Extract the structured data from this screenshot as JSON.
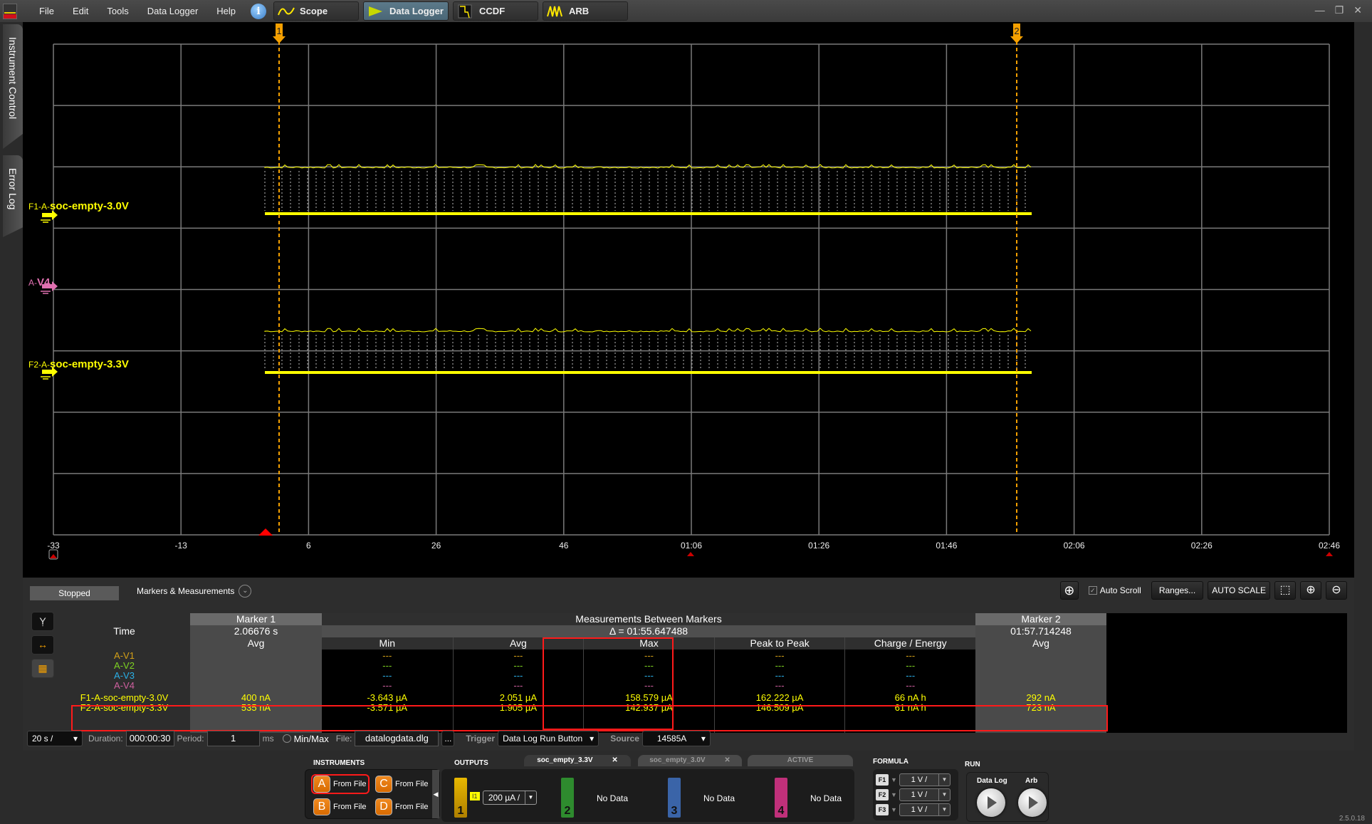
{
  "menubar": {
    "items": [
      "File",
      "Edit",
      "Tools",
      "Data Logger",
      "Help"
    ],
    "mode_tabs": [
      {
        "label": "Scope",
        "icon": "sine-wave-icon",
        "active": false
      },
      {
        "label": "Data Logger",
        "icon": "datalogger-icon",
        "active": true
      },
      {
        "label": "CCDF",
        "icon": "ccdf-icon",
        "active": false
      },
      {
        "label": "ARB",
        "icon": "arb-wave-icon",
        "active": false
      }
    ],
    "window_controls": {
      "minimize": "—",
      "restore": "❐",
      "close": "✕"
    }
  },
  "side_tabs": [
    "Instrument Control",
    "Error Log"
  ],
  "plot": {
    "x_ticks": [
      "-33",
      "-13",
      "6",
      "26",
      "46",
      "01:06",
      "01:26",
      "01:46",
      "02:06",
      "02:26",
      "02:46"
    ],
    "marker1_label": "1",
    "marker2_label": "2",
    "traces": [
      {
        "prefix": "F1-A-",
        "name": "soc-empty-3.0V",
        "color": "#ffff00"
      },
      {
        "prefix": "A-",
        "name": "V4",
        "color": "#e070b0"
      },
      {
        "prefix": "F2-A-",
        "name": "soc-empty-3.3V",
        "color": "#ffff00"
      }
    ],
    "nav": {
      "first": "<<",
      "prev": "<",
      "next": ">",
      "last": ">>"
    }
  },
  "colors": {
    "trace_yellow": "#ffff00",
    "marker_orange": "#f5a000",
    "highlight_red": "#ff1a1a",
    "v1": "#d4a017",
    "v2": "#7ed321",
    "v3": "#2ab0e8",
    "v4": "#d060a0"
  },
  "measurements": {
    "status": "Stopped",
    "section_label": "Markers & Measurements",
    "toolbar": {
      "auto_scroll": "Auto Scroll",
      "ranges": "Ranges...",
      "auto_scale": "AUTO SCALE"
    },
    "time_label": "Time",
    "marker1": {
      "title": "Marker 1",
      "time": "2.06676 s",
      "sub": "Avg"
    },
    "between": {
      "title": "Measurements Between Markers",
      "delta": "Δ = 01:55.647488"
    },
    "marker2": {
      "title": "Marker 2",
      "time": "01:57.714248",
      "sub": "Avg"
    },
    "columns": [
      "Min",
      "Avg",
      "Max",
      "Peak to Peak",
      "Charge / Energy"
    ],
    "empty_value": "---",
    "rows": [
      {
        "label": "A-V1",
        "color": "#d4a017",
        "m1": "",
        "min": "---",
        "avg": "---",
        "max": "---",
        "p2p": "---",
        "charge": "---",
        "m2": ""
      },
      {
        "label": "A-V2",
        "color": "#7ed321",
        "m1": "",
        "min": "---",
        "avg": "---",
        "max": "---",
        "p2p": "---",
        "charge": "---",
        "m2": ""
      },
      {
        "label": "A-V3",
        "color": "#2ab0e8",
        "m1": "",
        "min": "---",
        "avg": "---",
        "max": "---",
        "p2p": "---",
        "charge": "---",
        "m2": ""
      },
      {
        "label": "A-V4",
        "color": "#d060a0",
        "m1": "",
        "min": "---",
        "avg": "---",
        "max": "---",
        "p2p": "---",
        "charge": "---",
        "m2": ""
      },
      {
        "label": "F1-A-soc-empty-3.0V",
        "color": "#ffff00",
        "m1": "400 nA",
        "min": "-3.643 µA",
        "avg": "2.051 µA",
        "max": "158.579 µA",
        "p2p": "162.222 µA",
        "charge": "66 nA h",
        "m2": "292 nA"
      },
      {
        "label": "F2-A-soc-empty-3.3V",
        "color": "#ffff00",
        "m1": "535 nA",
        "min": "-3.571 µA",
        "avg": "1.905 µA",
        "max": "142.937 µA",
        "p2p": "146.509 µA",
        "charge": "61 nA h",
        "m2": "723 nA"
      }
    ],
    "settings": {
      "timebase": "20 s /",
      "duration_label": "Duration:",
      "duration": "000:00:30",
      "period_label": "Period:",
      "period": "1",
      "period_unit": "ms",
      "minmax_label": "Min/Max",
      "file_label": "File:",
      "file": "datalogdata.dlg",
      "browse": "...",
      "trigger_label": "Trigger",
      "trigger": "Data Log Run Button",
      "source_label": "Source",
      "source": "14585A"
    }
  },
  "bottom": {
    "instruments_title": "INSTRUMENTS",
    "instruments": [
      {
        "letter": "A",
        "label": "From File"
      },
      {
        "letter": "B",
        "label": "From File"
      },
      {
        "letter": "C",
        "label": "From File"
      },
      {
        "letter": "D",
        "label": "From File"
      }
    ],
    "outputs_title": "OUTPUTS",
    "output_tabs": [
      "soc_empty_3.3V",
      "soc_empty_3.0V",
      "ACTIVE"
    ],
    "channels": [
      {
        "num": "1",
        "color": "#d4a40a",
        "badge": "I1",
        "scale": "200 µA /"
      },
      {
        "num": "2",
        "color": "#2e8b2e",
        "status": "No Data"
      },
      {
        "num": "3",
        "color": "#3a64a8",
        "status": "No Data"
      },
      {
        "num": "4",
        "color": "#c0307a",
        "status": "No Data"
      }
    ],
    "formula_title": "FORMULA",
    "formulas": [
      {
        "name": "F1",
        "scale": "1 V /"
      },
      {
        "name": "F2",
        "scale": "1 V /"
      },
      {
        "name": "F3",
        "scale": "1 V /"
      }
    ],
    "run_title": "RUN",
    "run_buttons": [
      "Data Log",
      "Arb"
    ],
    "version": "2.5.0.18"
  }
}
